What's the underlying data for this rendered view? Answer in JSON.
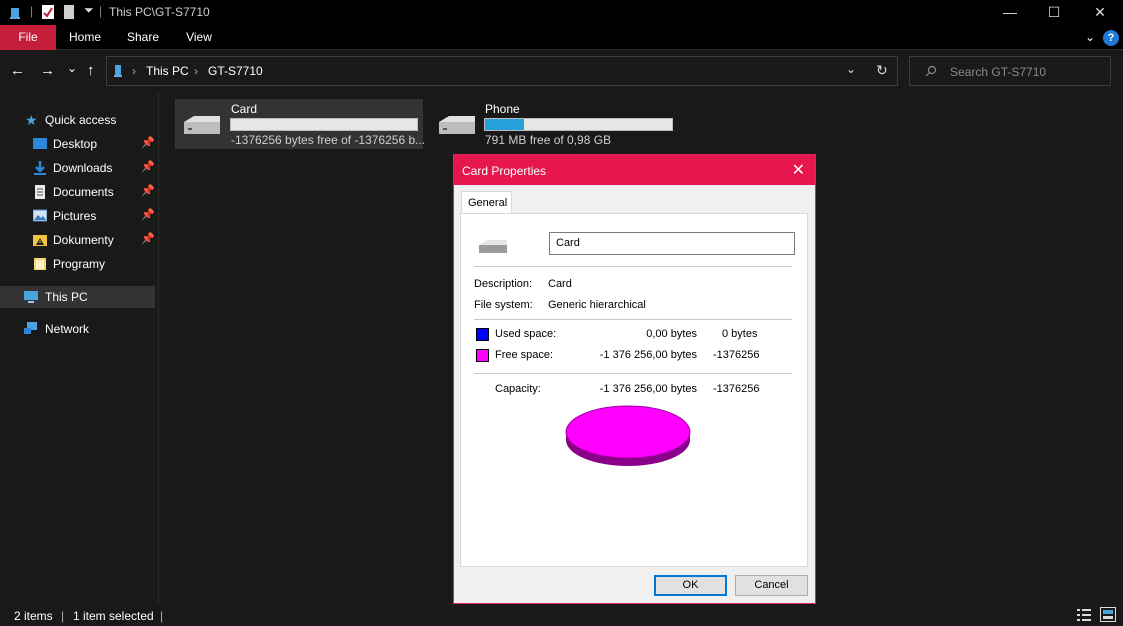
{
  "window": {
    "title": "This PC\\GT-S7710",
    "minimize_glyph": "—",
    "maximize_glyph": "☐",
    "close_glyph": "✕"
  },
  "ribbon": {
    "tabs": [
      "File",
      "Home",
      "Share",
      "View"
    ],
    "help_glyph": "?"
  },
  "nav": {
    "back": "←",
    "forward": "→",
    "recent": "⌄",
    "up": "↑",
    "breadcrumb": [
      "This PC",
      "GT-S7710"
    ],
    "breadcrumb_sep": "›",
    "dropdown": "⌄",
    "refresh": "↻",
    "search_placeholder": "Search GT-S7710"
  },
  "sidebar": {
    "items": [
      {
        "label": "Quick access",
        "icon": "star-icon"
      },
      {
        "label": "Desktop",
        "icon": "desktop-icon",
        "pinned": true
      },
      {
        "label": "Downloads",
        "icon": "download-icon",
        "pinned": true
      },
      {
        "label": "Documents",
        "icon": "documents-icon",
        "pinned": true
      },
      {
        "label": "Pictures",
        "icon": "pictures-icon",
        "pinned": true
      },
      {
        "label": "Dokumenty",
        "icon": "folder-warning-icon",
        "pinned": true
      },
      {
        "label": "Programy",
        "icon": "folder-icon"
      },
      {
        "label": "This PC",
        "icon": "computer-icon",
        "selected": true
      },
      {
        "label": "Network",
        "icon": "network-icon"
      }
    ],
    "pin_glyph": "📌"
  },
  "content": {
    "drives": [
      {
        "name": "Card",
        "info": "-1376256 bytes free of -1376256 b...",
        "used_fraction": 0.0,
        "selected": true
      },
      {
        "name": "Phone",
        "info": "791 MB free of 0,98 GB",
        "used_fraction": 0.21,
        "selected": false
      }
    ]
  },
  "status": {
    "items_count": "2 items",
    "selected_count": "1 item selected"
  },
  "dialog": {
    "title": "Card Properties",
    "close_glyph": "✕",
    "tab": "General",
    "name_value": "Card",
    "description_label": "Description:",
    "description_value": "Card",
    "filesystem_label": "File system:",
    "filesystem_value": "Generic hierarchical",
    "used_label": "Used space:",
    "used_bytes": "0,00 bytes",
    "used_short": "0 bytes",
    "free_label": "Free space:",
    "free_bytes": "-1 376 256,00 bytes",
    "free_short": "-1376256",
    "capacity_label": "Capacity:",
    "capacity_bytes": "-1 376 256,00 bytes",
    "capacity_short": "-1376256",
    "ok_label": "OK",
    "cancel_label": "Cancel",
    "colors": {
      "used": "#0000ff",
      "free": "#ff00ff",
      "accent": "#e6174f"
    },
    "pie_free_fraction": 1.0
  }
}
